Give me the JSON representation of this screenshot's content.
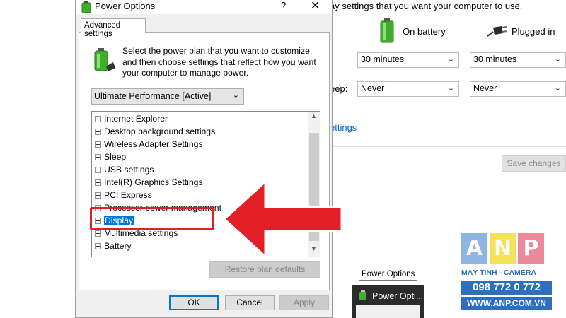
{
  "background_panel": {
    "header_text": "ay settings that you want your computer to use.",
    "on_battery_label": "On battery",
    "plugged_in_label": "Plugged in",
    "row1_battery_value": "30 minutes",
    "row1_plugged_value": "30 minutes",
    "row2_label": "eep:",
    "row2_battery_value": "Never",
    "row2_plugged_value": "Never",
    "link_text": "ettings",
    "save_changes_label": "Save changes"
  },
  "dialog": {
    "title": "Power Options",
    "help_symbol": "?",
    "close_symbol": "✕",
    "tab_label": "Advanced settings",
    "description": "Select the power plan that you want to customize, and then choose settings that reflect how you want your computer to manage power.",
    "plan_select_value": "Ultimate Performance [Active]",
    "tree_items": [
      "Internet Explorer",
      "Desktop background settings",
      "Wireless Adapter Settings",
      "Sleep",
      "USB settings",
      "Intel(R) Graphics Settings",
      "PCI Express",
      "Processor power management",
      "Display",
      "Multimedia settings",
      "Battery"
    ],
    "selected_item": "Display",
    "restore_label": "Restore plan defaults",
    "ok_label": "OK",
    "cancel_label": "Cancel",
    "apply_label": "Apply"
  },
  "taskbar": {
    "tooltip": "Power Options",
    "thumbnail_title": "Power Opti..."
  },
  "logo": {
    "letters": [
      "A",
      "N",
      "P"
    ],
    "subtitle": "MÁY TÍNH - CAMERA",
    "phone": "098 772 0 772",
    "website": "WWW.ANP.COM.VN",
    "colors": {
      "a": "#8fb6e3",
      "n": "#f5e25a",
      "p": "#ea8a9c",
      "blue": "#2f6ebd"
    }
  },
  "colors": {
    "accent": "#0078d7",
    "annotation_red": "#e21e26"
  }
}
